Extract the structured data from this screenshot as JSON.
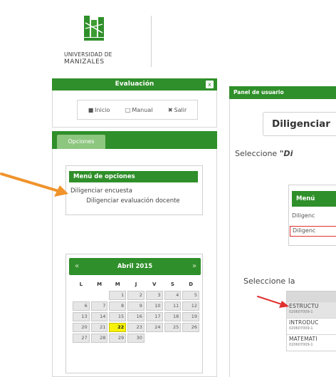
{
  "logo": {
    "line1": "UNIVERSIDAD DE",
    "line2": "MANIZALES"
  },
  "evaluacion": {
    "title": "Evaluación",
    "close_glyph": "x",
    "links": [
      {
        "label": "Inicio",
        "icon": "home-icon"
      },
      {
        "label": "Manual",
        "icon": "book-icon"
      },
      {
        "label": "Salir",
        "icon": "close-icon"
      }
    ]
  },
  "opciones": {
    "tab": "Opciones",
    "menu_title": "Menú de opciones",
    "items": [
      "Diligenciar encuesta",
      "Diligenciar evaluación docente"
    ]
  },
  "calendar": {
    "month": "Abril 2015",
    "prev_glyph": "«",
    "next_glyph": "»",
    "dow": [
      "L",
      "M",
      "M",
      "J",
      "V",
      "S",
      "D"
    ],
    "weeks": [
      [
        "",
        "",
        "1",
        "2",
        "3",
        "4",
        "5"
      ],
      [
        "6",
        "7",
        "8",
        "9",
        "10",
        "11",
        "12"
      ],
      [
        "13",
        "14",
        "15",
        "16",
        "17",
        "18",
        "19"
      ],
      [
        "20",
        "21",
        "22",
        "23",
        "24",
        "25",
        "26"
      ],
      [
        "27",
        "28",
        "29",
        "30",
        "",
        "",
        ""
      ]
    ],
    "today": "22"
  },
  "right_panel": {
    "title": "Panel de usuario",
    "heading": "Diligenciar",
    "select_prompt_prefix": "Seleccione ",
    "select_prompt_em": "\"Di",
    "menu_title": "Menú",
    "item1": "Diligenc",
    "item2": "Diligenc",
    "select_prompt2": "Seleccione la",
    "courses": [
      {
        "name": "ESTRUCTU",
        "code": "020607009-1"
      },
      {
        "name": "INTRODUC",
        "code": "020607009-1"
      },
      {
        "name": "MATEMATI",
        "code": "020607009-1"
      }
    ]
  },
  "colors": {
    "brand_green": "#2f8f2a",
    "tab_light_green": "#8dc67f",
    "today_highlight": "#f7f20a",
    "annotation_orange": "#f0932b",
    "annotation_red": "#e03030"
  }
}
